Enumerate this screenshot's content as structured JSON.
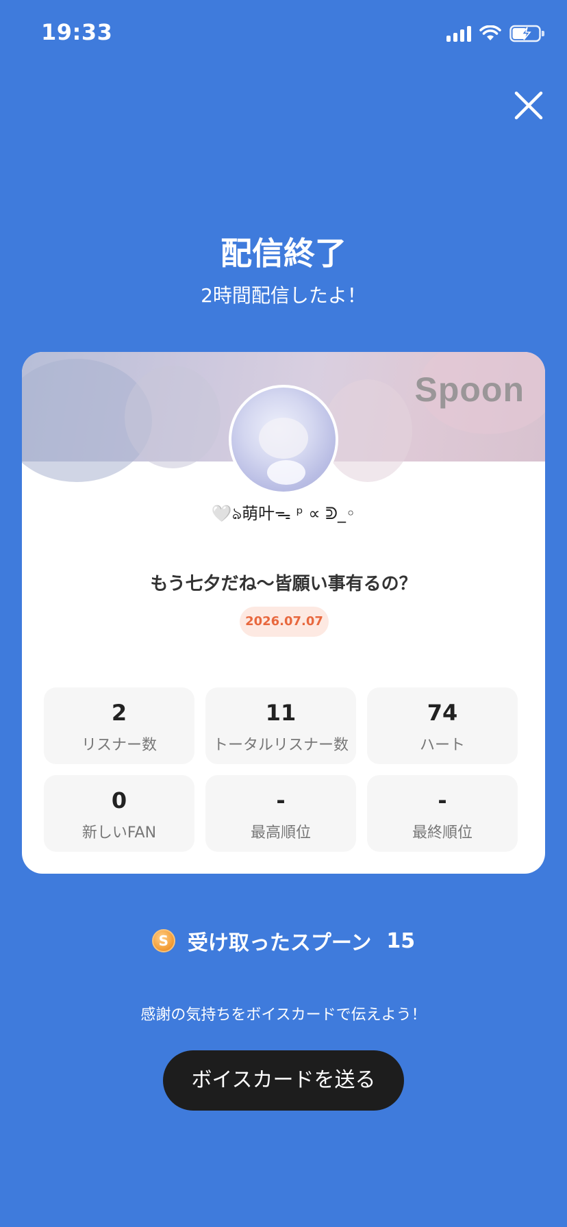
{
  "status_bar": {
    "time": "19:33"
  },
  "header": {
    "title": "配信終了",
    "subtitle": "2時間配信したよ！"
  },
  "card": {
    "banner_logo": "Spoon",
    "username": "🤍ঌ萌叶ᯓ ᵖ ∝ ᕲ_◦",
    "room_title": "もう七夕だね〜皆願い事有るの？",
    "date": "2026.07.07",
    "stats": [
      {
        "value": "2",
        "label": "リスナー数"
      },
      {
        "value": "11",
        "label": "トータルリスナー数"
      },
      {
        "value": "74",
        "label": "ハート"
      },
      {
        "value": "0",
        "label": "新しいFAN"
      },
      {
        "value": "-",
        "label": "最高順位"
      },
      {
        "value": "-",
        "label": "最終順位"
      }
    ]
  },
  "spoons": {
    "coin_symbol": "S",
    "label": "受け取ったスプーン",
    "count": "15"
  },
  "footer": {
    "thanks_text": "感謝の気持ちをボイスカードで伝えよう！",
    "voice_card_button": "ボイスカードを送る"
  },
  "colors": {
    "background": "#3f7bdc",
    "date_badge_text": "#e8683e",
    "date_badge_bg": "#fde9e2",
    "button_bg": "#1d1d1d"
  }
}
